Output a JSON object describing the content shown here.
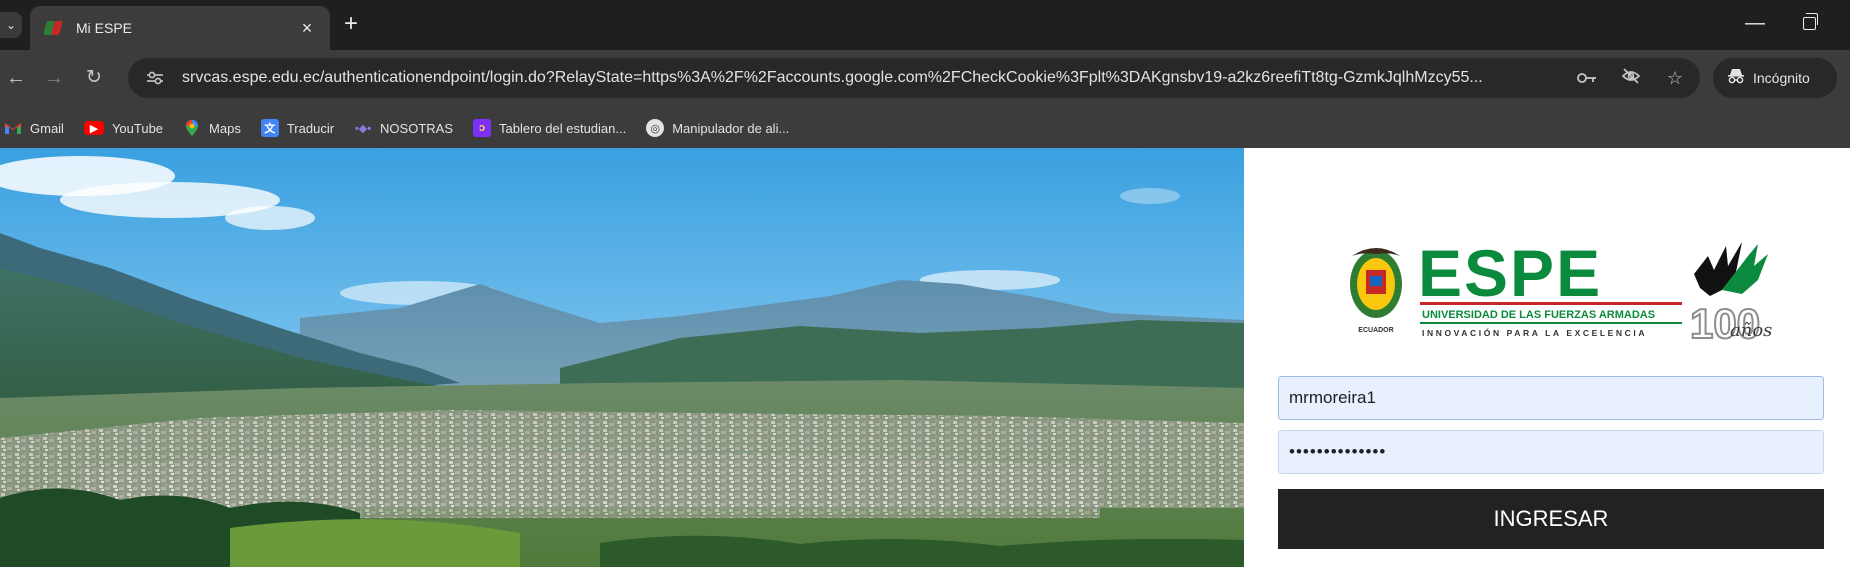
{
  "browser": {
    "tab": {
      "title": "Mi ESPE",
      "close": "×"
    },
    "new_tab": "+",
    "url": "srvcas.espe.edu.ec/authenticationendpoint/login.do?RelayState=https%3A%2F%2Faccounts.google.com%2FCheckCookie%3Fplt%3DAKgnsbv19-a2kz6reefiTt8tg-GzmkJqlhMzcy55...",
    "incognito_label": "Incógnito",
    "icons": {
      "tab_search": "chevron-down-icon",
      "back": "arrow-left-icon",
      "forward": "arrow-right-icon",
      "reload": "reload-icon",
      "site_info": "tune-icon",
      "password_key": "key-icon",
      "tracking": "eye-off-icon",
      "bookmark": "star-icon",
      "incognito": "incognito-icon"
    }
  },
  "bookmarks": [
    {
      "label": "Gmail",
      "icon": "gmail-icon",
      "color": "#ea4335"
    },
    {
      "label": "YouTube",
      "icon": "youtube-icon",
      "color": "#ff0000"
    },
    {
      "label": "Maps",
      "icon": "maps-icon",
      "color": "#34a853"
    },
    {
      "label": "Traducir",
      "icon": "translate-icon",
      "color": "#4285f4"
    },
    {
      "label": "NOSOTRAS",
      "icon": "nosotras-icon",
      "color": "#6a5acd"
    },
    {
      "label": "Tablero del estudian...",
      "icon": "tablero-icon",
      "color": "#7b2ff7"
    },
    {
      "label": "Manipulador de ali...",
      "icon": "globe-icon",
      "color": "#9aa0a6"
    }
  ],
  "login": {
    "logo": {
      "wordmark": "ESPE",
      "university": "UNIVERSIDAD DE LAS FUERZAS ARMADAS",
      "slogan": "INNOVACIÓN PARA LA EXCELENCIA",
      "anniversary": "100",
      "anniversary_suffix": "años",
      "seal_label": "ECUADOR"
    },
    "username": "mrmoreira1",
    "password": "••••••••••••••",
    "submit_label": "INGRESAR"
  },
  "colors": {
    "espe_green": "#0a8a3c",
    "button_bg": "#222222",
    "field_bg": "#e8f0fe"
  }
}
